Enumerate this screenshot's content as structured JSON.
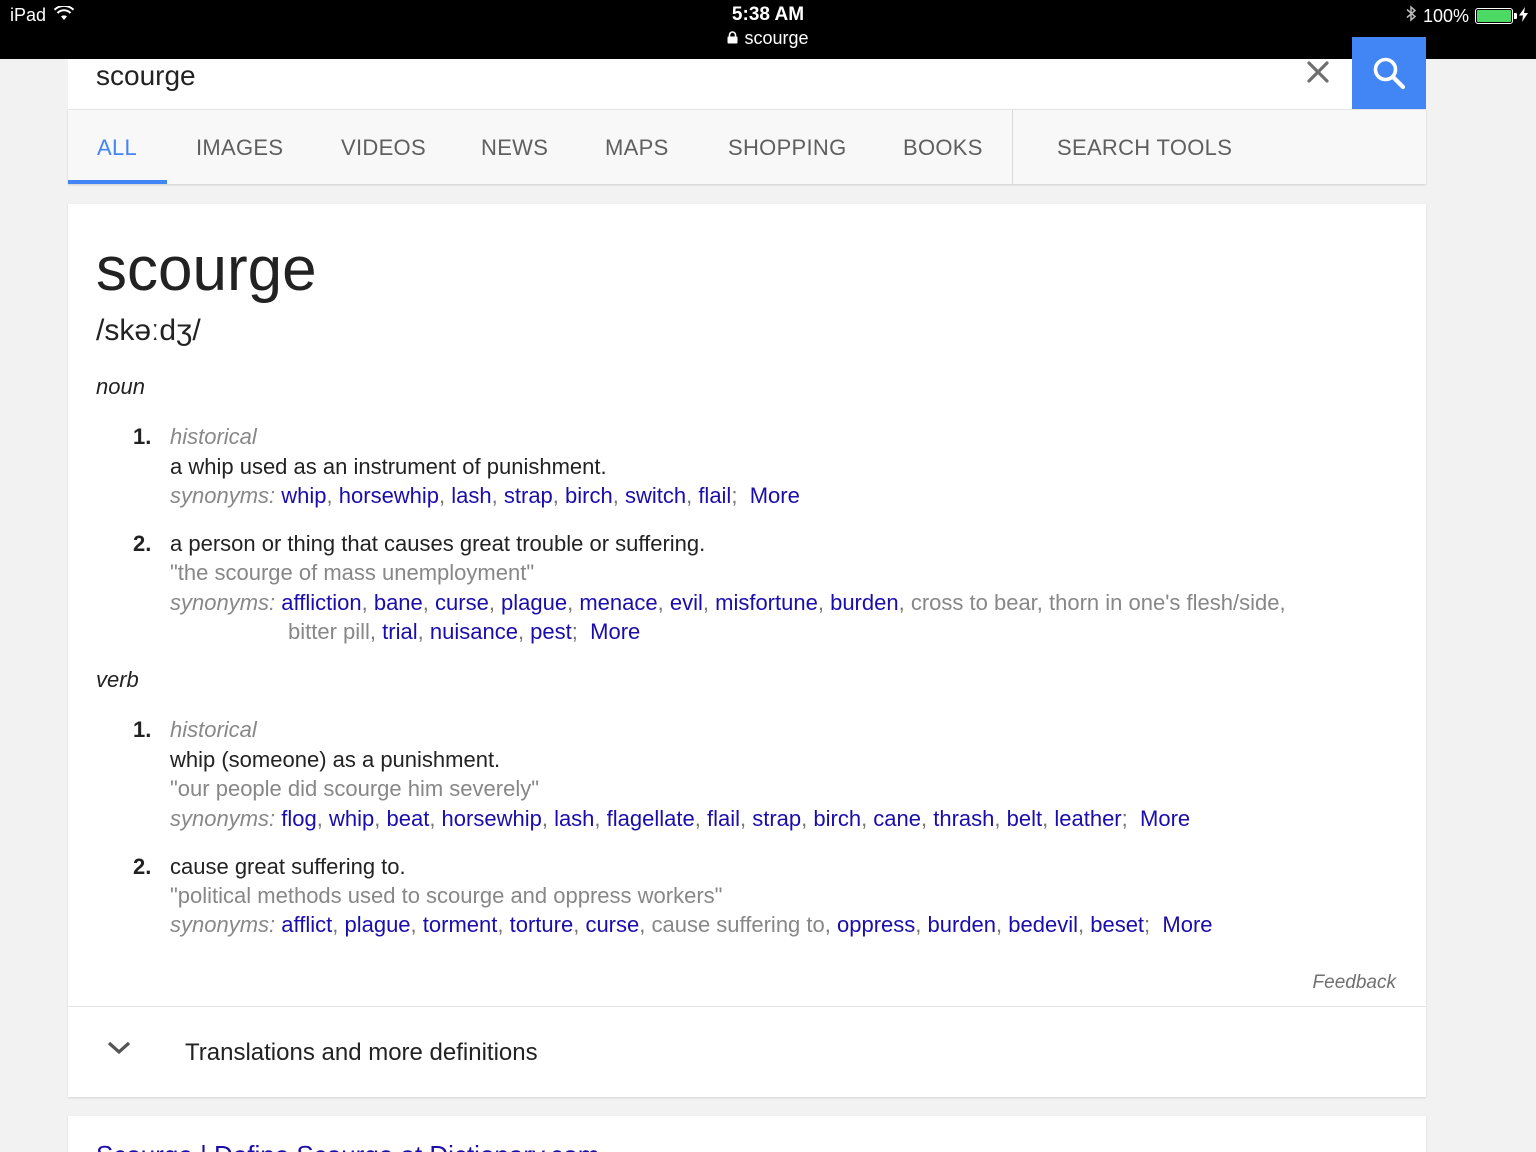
{
  "status_bar": {
    "device": "iPad",
    "time": "5:38 AM",
    "url": "scourge",
    "battery": "100%"
  },
  "search": {
    "query": "scourge"
  },
  "tabs": [
    {
      "label": "ALL",
      "active": true
    },
    {
      "label": "IMAGES"
    },
    {
      "label": "VIDEOS"
    },
    {
      "label": "NEWS"
    },
    {
      "label": "MAPS"
    },
    {
      "label": "SHOPPING"
    },
    {
      "label": "BOOKS"
    },
    {
      "label": "SEARCH TOOLS"
    }
  ],
  "definition": {
    "word": "scourge",
    "phonetic": "/skəːdʒ/",
    "noun_label": "noun",
    "verb_label": "verb",
    "synonyms_label": "synonyms:",
    "more_label": "More",
    "noun": [
      {
        "number": "1.",
        "label": "historical",
        "text": "a whip used as an instrument of punishment.",
        "synonyms": [
          "whip",
          "horsewhip",
          "lash",
          "strap",
          "birch",
          "switch",
          "flail"
        ]
      },
      {
        "number": "2.",
        "text": "a person or thing that causes great trouble or suffering.",
        "example": "\"the scourge of mass unemployment\"",
        "synonyms_line1": [
          "affliction",
          "bane",
          "curse",
          "plague",
          "menace",
          "evil",
          "misfortune",
          "burden"
        ],
        "plain1": "cross to bear, thorn in one's flesh/side,",
        "plain2": "bitter pill",
        "synonyms_line2": [
          "trial",
          "nuisance",
          "pest"
        ]
      }
    ],
    "verb": [
      {
        "number": "1.",
        "label": "historical",
        "text": "whip (someone) as a punishment.",
        "example": "\"our people did scourge him severely\"",
        "synonyms": [
          "flog",
          "whip",
          "beat",
          "horsewhip",
          "lash",
          "flagellate",
          "flail",
          "strap",
          "birch",
          "cane",
          "thrash",
          "belt",
          "leather"
        ]
      },
      {
        "number": "2.",
        "text": "cause great suffering to.",
        "example": "\"political methods used to scourge and oppress workers\"",
        "synonyms_a": [
          "afflict",
          "plague",
          "torment",
          "torture",
          "curse"
        ],
        "plain": "cause suffering to",
        "synonyms_b": [
          "oppress",
          "burden",
          "bedevil",
          "beset"
        ]
      }
    ],
    "feedback": "Feedback",
    "expander": "Translations and more definitions"
  },
  "next_result": {
    "title": "Scourge | Define Scourge at Dictionary.com"
  },
  "colors": {
    "accent": "#4285f4",
    "link": "#1a0dab",
    "battery": "#4cd964"
  }
}
